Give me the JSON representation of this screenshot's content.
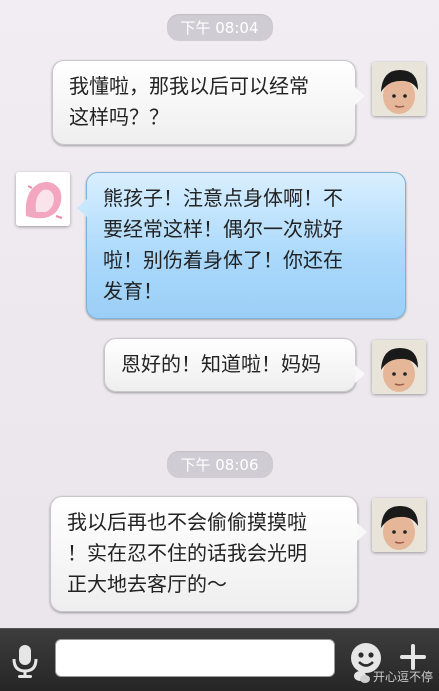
{
  "chat": {
    "timestamps": [
      "下午 08:04",
      "下午 08:06"
    ],
    "messages": [
      {
        "sender": "self",
        "lines": [
          "我懂啦，那我以后可以经常",
          "这样吗？？"
        ]
      },
      {
        "sender": "mom",
        "lines": [
          "熊孩子！注意点身体啊！不",
          "要经常这样！偶尔一次就好",
          "啦！别伤着身体了！你还在",
          "发育！"
        ]
      },
      {
        "sender": "self",
        "lines": [
          "恩好的！知道啦！妈妈"
        ]
      },
      {
        "sender": "self",
        "lines": [
          "我以后再也不会偷偷摸摸啦",
          "！实在忍不住的话我会光明",
          "正大地去客厅的～"
        ]
      }
    ]
  },
  "input_bar": {
    "message_value": "",
    "icons": [
      "microphone-icon",
      "emoji-icon",
      "plus-icon"
    ]
  },
  "watermark": {
    "text": "开心逗不停"
  },
  "colors": {
    "incoming_bubble": "#a9d8fb",
    "outgoing_bubble": "#f6f6f6",
    "timestamp_pill": "#cfcdd3",
    "input_bar": "#2f2f2f"
  }
}
